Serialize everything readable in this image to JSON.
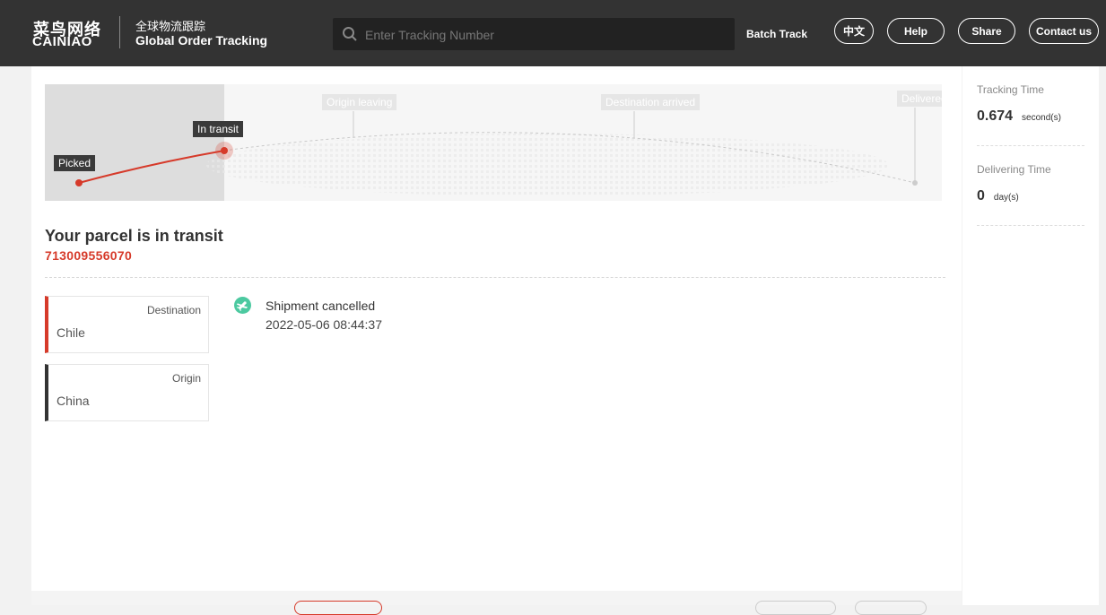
{
  "header": {
    "logo_cn": "菜鸟网络",
    "logo_en": "CAINIAO",
    "subtitle_cn": "全球物流跟踪",
    "subtitle_en": "Global Order Tracking",
    "search_placeholder": "Enter Tracking Number",
    "batch_track": "Batch Track",
    "buttons": [
      "中文",
      "Help",
      "Share",
      "Contact us"
    ],
    "search_icon": "search-icon"
  },
  "progress": {
    "stages": [
      "Picked",
      "In transit",
      "Origin leaving",
      "Destination arrived",
      "Delivered"
    ],
    "current_stage": "In transit",
    "accent_color": "#d63a2a"
  },
  "parcel": {
    "status_title": "Your parcel is in transit",
    "tracking_number": "713009556070"
  },
  "route": {
    "destination_label": "Destination",
    "destination_value": "Chile",
    "origin_label": "Origin",
    "origin_value": "China"
  },
  "events": [
    {
      "title": "Shipment cancelled",
      "time": "2022-05-06 08:44:37",
      "icon": "airplane-icon"
    }
  ],
  "stats": {
    "tracking_time_label": "Tracking Time",
    "tracking_time_value": "0.674",
    "tracking_time_unit": "second(s)",
    "delivering_time_label": "Delivering Time",
    "delivering_time_value": "0",
    "delivering_time_unit": "day(s)"
  },
  "colors": {
    "header_bg": "#333333",
    "accent_red": "#d63a2a",
    "event_icon": "#4cc9a0"
  }
}
